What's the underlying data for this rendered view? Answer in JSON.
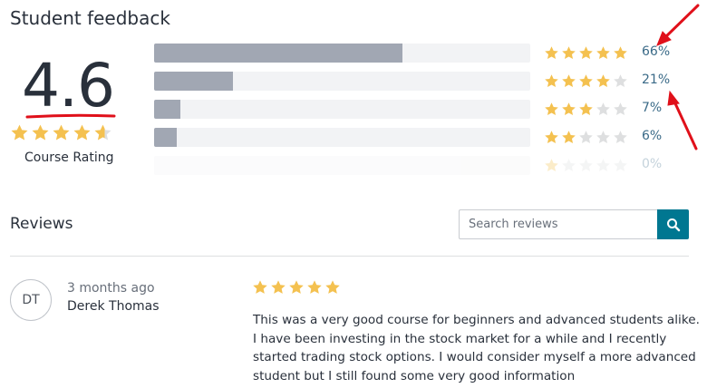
{
  "header": {
    "title": "Student feedback"
  },
  "summary": {
    "rating": "4.6",
    "rating_value": 4.6,
    "label": "Course Rating"
  },
  "breakdown": [
    {
      "stars": 5,
      "percent_label": "66%",
      "percent": 66
    },
    {
      "stars": 4,
      "percent_label": "21%",
      "percent": 21
    },
    {
      "stars": 3,
      "percent_label": "7%",
      "percent": 7
    },
    {
      "stars": 2,
      "percent_label": "6%",
      "percent": 6
    },
    {
      "stars": 1,
      "percent_label": "0%",
      "percent": 0
    }
  ],
  "reviews": {
    "heading": "Reviews",
    "search_placeholder": "Search reviews",
    "search_icon": "search-icon",
    "items": [
      {
        "initials": "DT",
        "time": "3 months ago",
        "name": "Derek Thomas",
        "stars": 5,
        "text": "This was a very good course for beginners and advanced students alike. I have been investing in the stock market for a while and I recently started trading stock options. I would consider myself a more advanced student but I still found some very good information"
      }
    ]
  },
  "colors": {
    "star_filled": "#f4c150",
    "star_empty": "#dedfe0",
    "bar_fill": "#a1a7b3",
    "bar_track": "#f2f3f5",
    "percent_link": "#3b6b88",
    "search_button": "#007791",
    "annotation": "#e0101a"
  }
}
